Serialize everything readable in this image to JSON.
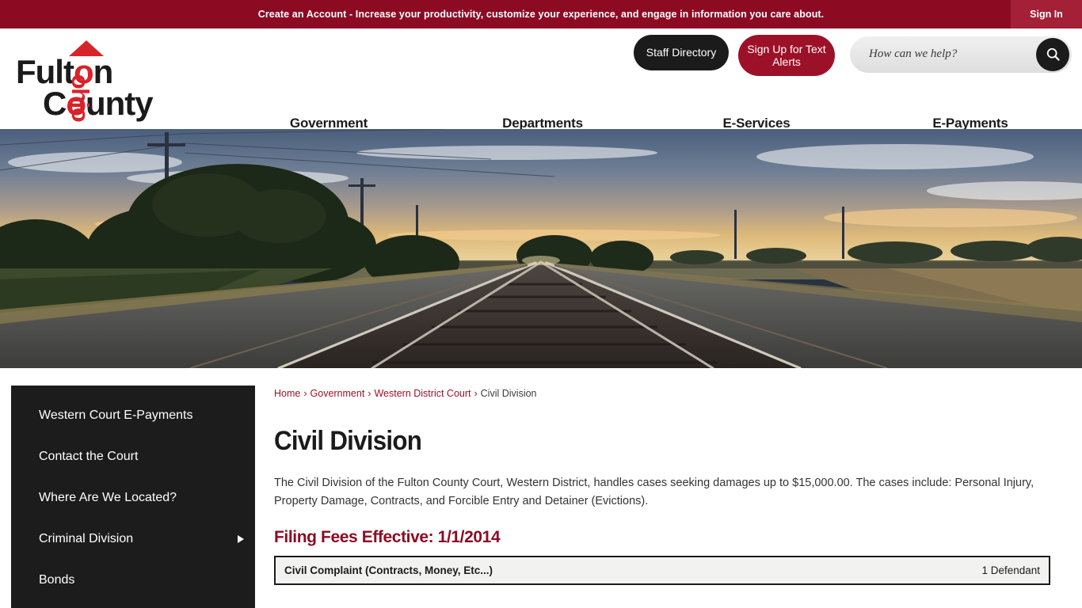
{
  "alert_bar": {
    "message": "Create an Account - Increase your productivity, customize your experience, and engage in information you care about.",
    "sign_in_label": "Sign In",
    "background_color": "#8c0b23",
    "sign_in_background_color": "#a32036"
  },
  "logo": {
    "line1": "Fult",
    "line1_accent": "o",
    "line1_end": "n",
    "line2_start": "C",
    "line2_accent": "o",
    "line2_end": "unty",
    "vertical_word": "ohio",
    "accent_color": "#d8232a",
    "text_color": "#1b1b1b"
  },
  "header": {
    "staff_directory_label": "Staff Directory",
    "text_alerts_label": "Sign Up for Text Alerts",
    "search": {
      "placeholder": "How can we help?",
      "value": "",
      "icon": "search-icon"
    },
    "nav": [
      {
        "label": "Government"
      },
      {
        "label": "Departments"
      },
      {
        "label": "E-Services"
      },
      {
        "label": "E-Payments"
      }
    ]
  },
  "hero": {
    "alt": "Railroad tracks at sunset running through farmland"
  },
  "sidebar": {
    "items": [
      {
        "label": "Western Court E-Payments",
        "has_submenu": false
      },
      {
        "label": "Contact the Court",
        "has_submenu": false
      },
      {
        "label": "Where Are We Located?",
        "has_submenu": false
      },
      {
        "label": "Criminal Division",
        "has_submenu": true
      },
      {
        "label": "Bonds",
        "has_submenu": false
      }
    ]
  },
  "main": {
    "breadcrumb": [
      {
        "label": "Home",
        "link": true
      },
      {
        "label": "Government",
        "link": true
      },
      {
        "label": "Western District Court",
        "link": true
      },
      {
        "label": "Civil Division",
        "link": false
      }
    ],
    "breadcrumb_separator": "›",
    "page_title": "Civil Division",
    "intro_paragraph": "The Civil Division of the Fulton County Court, Western District, handles cases seeking damages up to $15,000.00. The cases include: Personal Injury, Property Damage, Contracts, and Forcible Entry and Detainer (Evictions).",
    "fees_heading": "Filing Fees Effective: 1/1/2014",
    "fee_table": {
      "rows": [
        {
          "description": "Civil Complaint (Contracts, Money, Etc...)",
          "quantity": "1 Defendant"
        }
      ]
    }
  }
}
